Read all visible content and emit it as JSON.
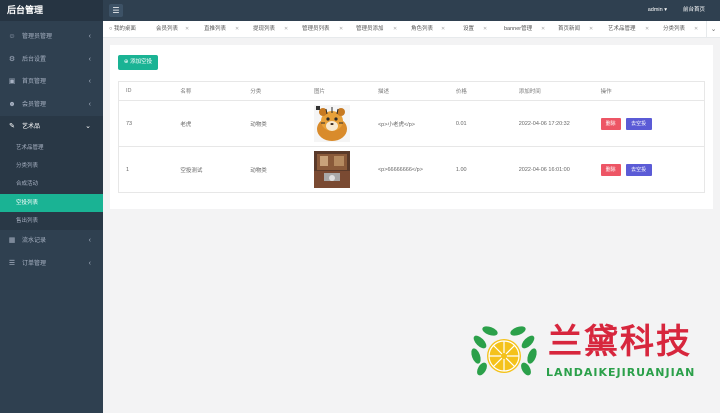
{
  "brand": "后台管理",
  "sidebar": {
    "items": [
      {
        "label": "管理员管理",
        "icon": "user-icon"
      },
      {
        "label": "后台设置",
        "icon": "gear-icon"
      },
      {
        "label": "首页管理",
        "icon": "home-icon"
      },
      {
        "label": "会员管理",
        "icon": "member-icon"
      },
      {
        "label": "艺术品",
        "icon": "art-icon"
      },
      {
        "label": "流水记录",
        "icon": "grid-icon"
      },
      {
        "label": "订单管理",
        "icon": "order-icon"
      }
    ],
    "sub_items": [
      "艺术品管理",
      "分类列表",
      "合成活动",
      "空投列表",
      "售出列表"
    ]
  },
  "header": {
    "menu_icon": "menu-icon",
    "admin": "admin",
    "front": "前台首页"
  },
  "tabs": [
    "我的桌面",
    "会员列表",
    "直推列表",
    "提现列表",
    "管理员列表",
    "管理员添加",
    "角色列表",
    "设置",
    "banner管理",
    "首页新闻",
    "艺术品管理",
    "分类列表"
  ],
  "content": {
    "add_button": "添加空投",
    "columns": [
      "ID",
      "名称",
      "分类",
      "图片",
      "描述",
      "价格",
      "添加时间",
      "操作"
    ],
    "rows": [
      {
        "id": "73",
        "name": "老虎",
        "category": "动物类",
        "image": "tiger-image",
        "desc": "<p>小老虎</p>",
        "price": "0.01",
        "time": "2022-04-06 17:20:32",
        "delete": "删除",
        "action": "去空投"
      },
      {
        "id": "1",
        "name": "空投测试",
        "category": "动物类",
        "image": "room-image",
        "desc": "<p>66666666</p>",
        "price": "1.00",
        "time": "2022-04-06 16:01:00",
        "delete": "删除",
        "action": "去空投"
      }
    ]
  },
  "watermark": {
    "title": "兰黛科技",
    "subtitle": "LANDAIKEJIRUANJIAN"
  },
  "colors": {
    "sidebar": "#2f4050",
    "accent": "#1ab394",
    "danger": "#ed5565",
    "primary": "#5b5bd6",
    "logo_red": "#d7263d",
    "logo_green": "#2ba04a"
  }
}
